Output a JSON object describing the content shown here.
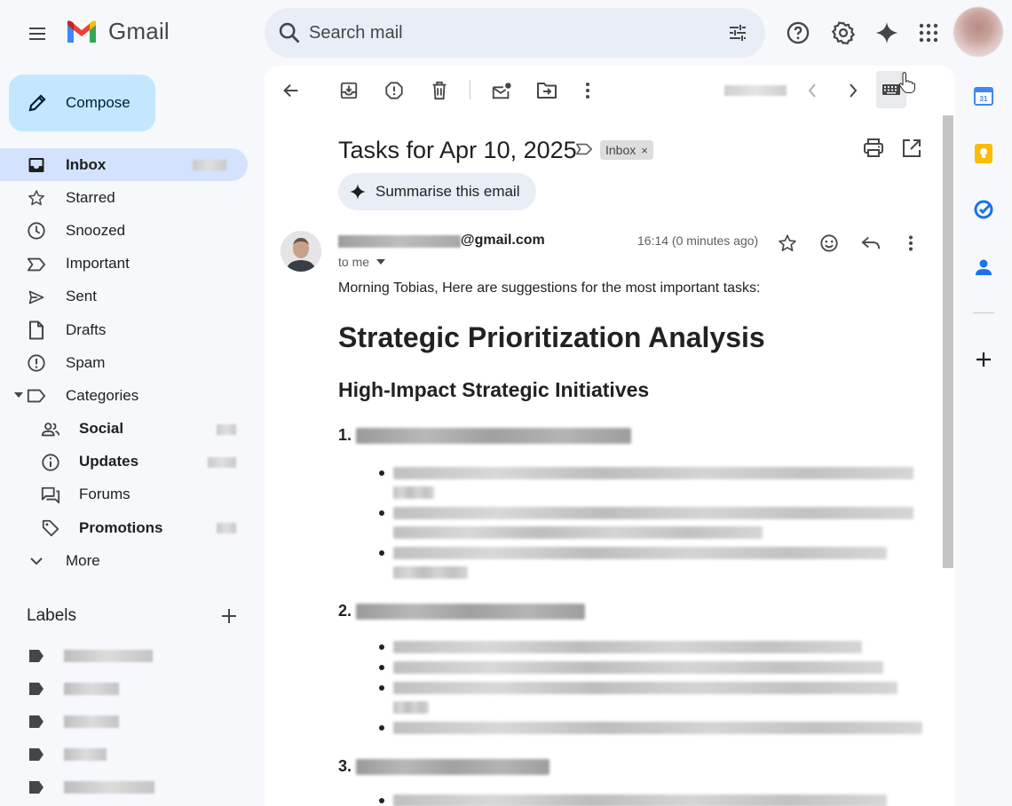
{
  "app": {
    "name": "Gmail"
  },
  "search": {
    "placeholder": "Search mail"
  },
  "sidebar": {
    "compose_label": "Compose",
    "items": [
      {
        "label": "Inbox",
        "icon": "inbox-icon",
        "active": true
      },
      {
        "label": "Starred",
        "icon": "star-icon"
      },
      {
        "label": "Snoozed",
        "icon": "clock-icon"
      },
      {
        "label": "Important",
        "icon": "important-icon"
      },
      {
        "label": "Sent",
        "icon": "send-icon"
      },
      {
        "label": "Drafts",
        "icon": "draft-icon"
      },
      {
        "label": "Spam",
        "icon": "spam-icon"
      },
      {
        "label": "Categories",
        "icon": "label-icon"
      },
      {
        "label": "Social",
        "icon": "people-icon"
      },
      {
        "label": "Updates",
        "icon": "info-icon"
      },
      {
        "label": "Forums",
        "icon": "forum-icon"
      },
      {
        "label": "Promotions",
        "icon": "tag-icon"
      },
      {
        "label": "More",
        "icon": "chevron-down-icon"
      }
    ],
    "labels_heading": "Labels"
  },
  "email": {
    "subject": "Tasks for Apr 10, 2025",
    "inbox_chip": "Inbox",
    "chip_close": "×",
    "summarise_label": "Summarise this email",
    "sender_domain": "@gmail.com",
    "to_me": "to me",
    "timestamp": "16:14 (0 minutes ago)",
    "greeting": "Morning Tobias, Here are suggestions for the most important tasks:",
    "heading1": "Strategic Prioritization Analysis",
    "heading2": "High-Impact Strategic Initiatives",
    "item_numbers": [
      "1.",
      "2.",
      "3."
    ]
  },
  "colors": {
    "compose_bg": "#c2e7ff",
    "active_nav_bg": "#d3e3fd",
    "search_bg": "#e9eef6",
    "app_bg": "#f6f8fc"
  }
}
